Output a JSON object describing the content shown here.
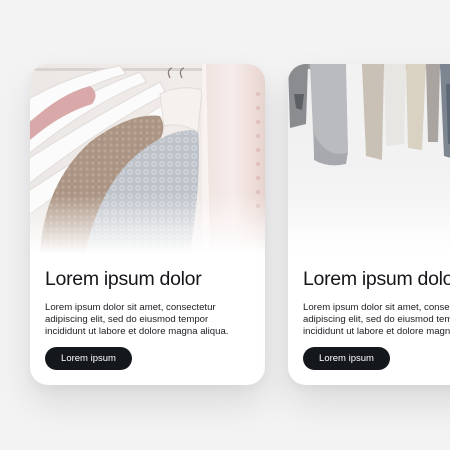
{
  "cards": [
    {
      "title": "Lorem ipsum dolor",
      "description_lines": [
        "Lorem ipsum dolor sit amet, consectetur",
        "adipiscing elit, sed do eiusmod tempor",
        "incididunt ut labore et dolore magna aliqua."
      ],
      "button_label": "Lorem ipsum",
      "image_subject": "knitwear-on-white-hangers"
    },
    {
      "title": "Lorem ipsum dolor",
      "description_lines": [
        "Lorem ipsum dolor sit amet, consectetur",
        "adipiscing elit, sed do eiusmod tempor",
        "incididunt ut labore et dolore magna aliqua."
      ],
      "button_label": "Lorem ipsum",
      "image_subject": "shirts-and-jackets-on-rail"
    }
  ],
  "colors": {
    "page_background": "#f3f3f4",
    "card_background": "#ffffff",
    "button_background": "#14171c",
    "button_text": "#ffffff",
    "title_text": "#14161a"
  }
}
